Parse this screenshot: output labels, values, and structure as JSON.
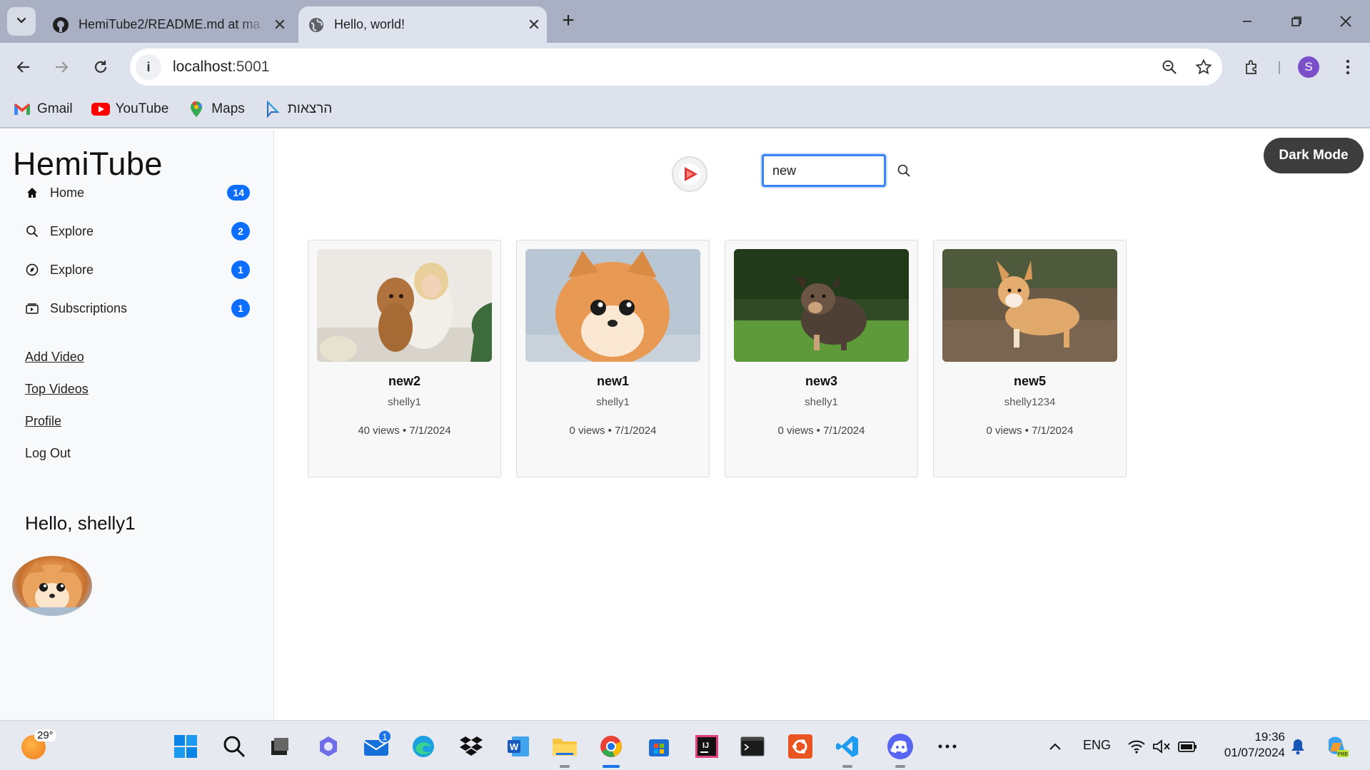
{
  "browser": {
    "tabs": [
      {
        "title": "HemiTube2/README.md at ma",
        "favicon": "github-icon",
        "active": false
      },
      {
        "title": "Hello, world!",
        "favicon": "globe-icon",
        "active": true
      }
    ],
    "url_host": "localhost",
    "url_port": ":5001",
    "profile_initial": "S",
    "bookmarks": [
      {
        "label": "Gmail",
        "icon": "gmail-icon"
      },
      {
        "label": "YouTube",
        "icon": "youtube-icon"
      },
      {
        "label": "Maps",
        "icon": "maps-icon"
      },
      {
        "label": "הרצאות",
        "icon": "bookmark-folder-icon"
      }
    ]
  },
  "sidebar": {
    "brand": "HemiTube",
    "nav": [
      {
        "label": "Home",
        "icon": "home-icon",
        "badge": "14"
      },
      {
        "label": "Explore",
        "icon": "search-icon",
        "badge": "2"
      },
      {
        "label": "Explore",
        "icon": "compass-icon",
        "badge": "1"
      },
      {
        "label": "Subscriptions",
        "icon": "subscriptions-icon",
        "badge": "1"
      }
    ],
    "links": [
      "Add Video",
      "Top Videos",
      "Profile"
    ],
    "logout": "Log Out",
    "greeting": "Hello, shelly1"
  },
  "header": {
    "search_value": "new",
    "dark_mode_label": "Dark Mode"
  },
  "videos": [
    {
      "title": "new2",
      "user": "shelly1",
      "meta": "40 views • 7/1/2024",
      "thumb": "woman-with-poodle"
    },
    {
      "title": "new1",
      "user": "shelly1",
      "meta": "0 views • 7/1/2024",
      "thumb": "fluffy-pomeranian"
    },
    {
      "title": "new3",
      "user": "shelly1",
      "meta": "0 views • 7/1/2024",
      "thumb": "dog-on-grass"
    },
    {
      "title": "new5",
      "user": "shelly1234",
      "meta": "0 views • 7/1/2024",
      "thumb": "corgi-on-ground"
    }
  ],
  "taskbar": {
    "weather_temp": "29°",
    "mail_badge": "1",
    "language": "ENG",
    "time": "19:36",
    "date": "01/07/2024"
  },
  "colors": {
    "accent": "#0d6efd",
    "dark_button": "#3d3d3d",
    "chrome_bg": "#dde2ec",
    "tabstrip_bg": "#a9b0c3"
  }
}
